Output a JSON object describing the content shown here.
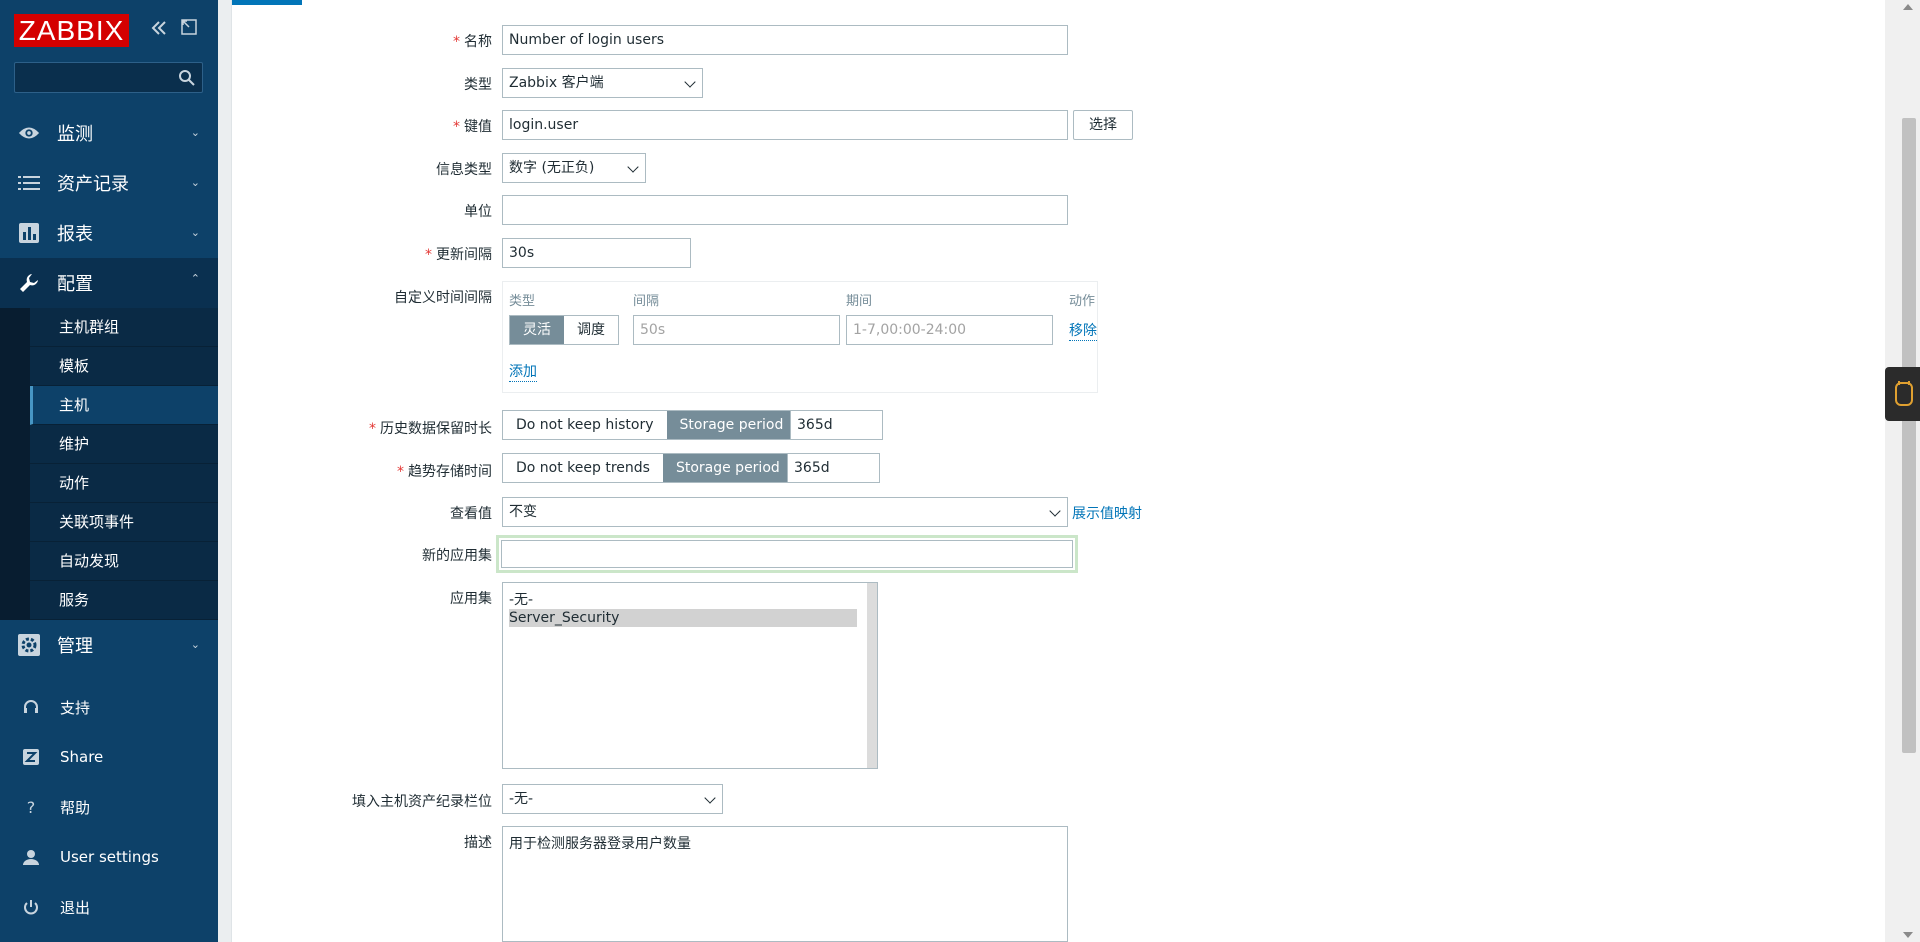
{
  "sidebar": {
    "logo": "ZABBIX",
    "search": {
      "placeholder": ""
    },
    "menu": [
      {
        "label": "监测",
        "icon": "eye-icon"
      },
      {
        "label": "资产记录",
        "icon": "list-icon"
      },
      {
        "label": "报表",
        "icon": "bar-chart-icon"
      },
      {
        "label": "配置",
        "icon": "wrench-icon"
      }
    ],
    "submenu": [
      {
        "label": "主机群组"
      },
      {
        "label": "模板"
      },
      {
        "label": "主机"
      },
      {
        "label": "维护"
      },
      {
        "label": "动作"
      },
      {
        "label": "关联项事件"
      },
      {
        "label": "自动发现"
      },
      {
        "label": "服务"
      }
    ],
    "admin": {
      "label": "管理",
      "icon": "gear-icon"
    },
    "bottom": [
      {
        "label": "支持",
        "icon": "headset-icon"
      },
      {
        "label": "Share",
        "icon": "share-icon"
      },
      {
        "label": "帮助",
        "icon": "help-icon"
      },
      {
        "label": "User settings",
        "icon": "user-icon"
      },
      {
        "label": "退出",
        "icon": "power-icon"
      }
    ]
  },
  "form": {
    "name": {
      "label": "名称",
      "value": "Number of login users"
    },
    "type": {
      "label": "类型",
      "value": "Zabbix 客户端"
    },
    "key": {
      "label": "键值",
      "value": "login.user",
      "button": "选择"
    },
    "info_type": {
      "label": "信息类型",
      "value": "数字 (无正负)"
    },
    "units": {
      "label": "单位",
      "value": ""
    },
    "interval": {
      "label": "更新间隔",
      "value": "30s"
    },
    "custom_intervals": {
      "label": "自定义时间间隔",
      "headers": {
        "type": "类型",
        "interval": "间隔",
        "period": "期间",
        "action": "动作"
      },
      "toggle_flexible": "灵活",
      "toggle_scheduling": "调度",
      "interval_placeholder": "50s",
      "period_placeholder": "1-7,00:00-24:00",
      "remove": "移除",
      "add": "添加"
    },
    "history": {
      "label": "历史数据保留时长",
      "off": "Do not keep history",
      "on": "Storage period",
      "value": "365d"
    },
    "trends": {
      "label": "趋势存储时间",
      "off": "Do not keep trends",
      "on": "Storage period",
      "value": "365d"
    },
    "valuemap": {
      "label": "查看值",
      "value": "不变",
      "link": "展示值映射"
    },
    "new_app": {
      "label": "新的应用集",
      "value": ""
    },
    "apps": {
      "label": "应用集",
      "options": [
        "-无-",
        "Server_Security"
      ]
    },
    "inventory": {
      "label": "填入主机资产纪录栏位",
      "value": "-无-"
    },
    "description": {
      "label": "描述",
      "value": "用于检测服务器登录用户数量"
    }
  }
}
